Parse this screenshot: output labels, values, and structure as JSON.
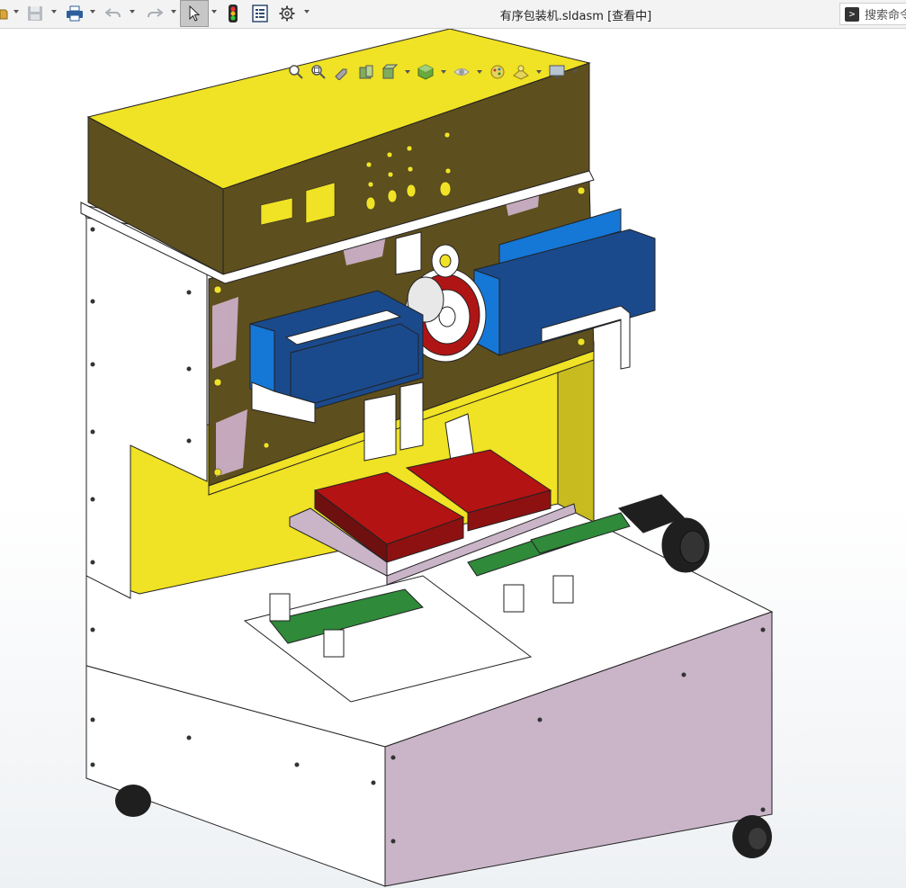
{
  "window": {
    "title": "有序包装机.sldasm [查看中]"
  },
  "toolbar": {
    "tools": [
      {
        "icon": "open-icon"
      },
      {
        "icon": "save-icon"
      },
      {
        "icon": "print-icon"
      },
      {
        "icon": "undo-icon"
      },
      {
        "icon": "redo-icon"
      },
      {
        "icon": "select-cursor-icon",
        "active": true
      },
      {
        "icon": "traffic-light-icon"
      },
      {
        "icon": "file-properties-icon"
      },
      {
        "icon": "gear-icon"
      }
    ],
    "search_label": "搜索命令"
  },
  "heads_up_view": {
    "tools": [
      "zoom-to-fit-icon",
      "zoom-to-area-icon",
      "previous-view-icon",
      "section-view-icon",
      "view-orientation-icon",
      "display-style-icon",
      "hide-show-items-icon",
      "edit-appearance-icon",
      "apply-scene-icon",
      "view-settings-icon"
    ]
  },
  "model": {
    "name": "有序包装机",
    "colors": {
      "cabinet_yellow": "#f0e224",
      "cabinet_yellow_dark": "#5e4f1e",
      "frame_white": "#ffffff",
      "panel_lilac": "#c9b4c8",
      "actuator_blue": "#1a4a8c",
      "actuator_blue_light": "#1577d6",
      "tray_red": "#b31313",
      "belt_green": "#2f8a3a",
      "motor_black": "#1f1f1f",
      "background": "#ffffff"
    }
  }
}
